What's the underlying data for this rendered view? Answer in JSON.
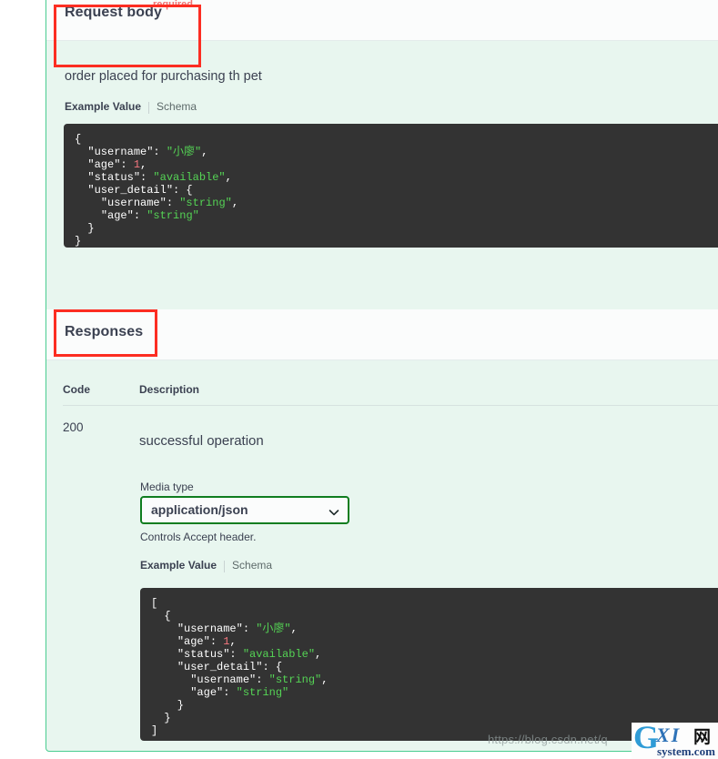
{
  "request_body": {
    "title": "Request body",
    "required_label": "required",
    "description": "order placed for purchasing th pet",
    "tabs": {
      "active": "Example Value",
      "inactive": "Schema"
    },
    "example_lines": [
      [
        {
          "t": "{",
          "c": "pun"
        }
      ],
      [
        {
          "t": "  ",
          "c": "pun"
        },
        {
          "t": "\"username\"",
          "c": "k"
        },
        {
          "t": ": ",
          "c": "pun"
        },
        {
          "t": "\"小廖\"",
          "c": "str"
        },
        {
          "t": ",",
          "c": "pun"
        }
      ],
      [
        {
          "t": "  ",
          "c": "pun"
        },
        {
          "t": "\"age\"",
          "c": "k"
        },
        {
          "t": ": ",
          "c": "pun"
        },
        {
          "t": "1",
          "c": "num"
        },
        {
          "t": ",",
          "c": "pun"
        }
      ],
      [
        {
          "t": "  ",
          "c": "pun"
        },
        {
          "t": "\"status\"",
          "c": "k"
        },
        {
          "t": ": ",
          "c": "pun"
        },
        {
          "t": "\"available\"",
          "c": "str"
        },
        {
          "t": ",",
          "c": "pun"
        }
      ],
      [
        {
          "t": "  ",
          "c": "pun"
        },
        {
          "t": "\"user_detail\"",
          "c": "k"
        },
        {
          "t": ": {",
          "c": "pun"
        }
      ],
      [
        {
          "t": "    ",
          "c": "pun"
        },
        {
          "t": "\"username\"",
          "c": "k"
        },
        {
          "t": ": ",
          "c": "pun"
        },
        {
          "t": "\"string\"",
          "c": "str"
        },
        {
          "t": ",",
          "c": "pun"
        }
      ],
      [
        {
          "t": "    ",
          "c": "pun"
        },
        {
          "t": "\"age\"",
          "c": "k"
        },
        {
          "t": ": ",
          "c": "pun"
        },
        {
          "t": "\"string\"",
          "c": "str"
        }
      ],
      [
        {
          "t": "  }",
          "c": "pun"
        }
      ],
      [
        {
          "t": "}",
          "c": "pun"
        }
      ]
    ]
  },
  "responses": {
    "title": "Responses",
    "columns": [
      "Code",
      "Description"
    ],
    "rows": [
      {
        "code": "200",
        "description": "successful operation",
        "media_type_label": "Media type",
        "media_type_value": "application/json",
        "media_type_options": [
          "application/json"
        ],
        "accept_note": "Controls Accept header.",
        "tabs": {
          "active": "Example Value",
          "inactive": "Schema"
        },
        "example_lines": [
          [
            {
              "t": "[",
              "c": "pun"
            }
          ],
          [
            {
              "t": "  {",
              "c": "pun"
            }
          ],
          [
            {
              "t": "    ",
              "c": "pun"
            },
            {
              "t": "\"username\"",
              "c": "k"
            },
            {
              "t": ": ",
              "c": "pun"
            },
            {
              "t": "\"小廖\"",
              "c": "str"
            },
            {
              "t": ",",
              "c": "pun"
            }
          ],
          [
            {
              "t": "    ",
              "c": "pun"
            },
            {
              "t": "\"age\"",
              "c": "k"
            },
            {
              "t": ": ",
              "c": "pun"
            },
            {
              "t": "1",
              "c": "num"
            },
            {
              "t": ",",
              "c": "pun"
            }
          ],
          [
            {
              "t": "    ",
              "c": "pun"
            },
            {
              "t": "\"status\"",
              "c": "k"
            },
            {
              "t": ": ",
              "c": "pun"
            },
            {
              "t": "\"available\"",
              "c": "str"
            },
            {
              "t": ",",
              "c": "pun"
            }
          ],
          [
            {
              "t": "    ",
              "c": "pun"
            },
            {
              "t": "\"user_detail\"",
              "c": "k"
            },
            {
              "t": ": {",
              "c": "pun"
            }
          ],
          [
            {
              "t": "      ",
              "c": "pun"
            },
            {
              "t": "\"username\"",
              "c": "k"
            },
            {
              "t": ": ",
              "c": "pun"
            },
            {
              "t": "\"string\"",
              "c": "str"
            },
            {
              "t": ",",
              "c": "pun"
            }
          ],
          [
            {
              "t": "      ",
              "c": "pun"
            },
            {
              "t": "\"age\"",
              "c": "k"
            },
            {
              "t": ": ",
              "c": "pun"
            },
            {
              "t": "\"string\"",
              "c": "str"
            }
          ],
          [
            {
              "t": "    }",
              "c": "pun"
            }
          ],
          [
            {
              "t": "  }",
              "c": "pun"
            }
          ],
          [
            {
              "t": "]",
              "c": "pun"
            }
          ]
        ]
      }
    ]
  },
  "watermark": {
    "url": "https://blog.csdn.net/q",
    "logo_g": "G",
    "logo_xi": "XI",
    "logo_wang": "网",
    "logo_sub": "system.com"
  },
  "colors": {
    "panel_border": "#49cc90",
    "panel_bg": "#e8f6ef",
    "header_bg": "#fbfcfc",
    "code_bg": "#333333",
    "string_green": "#55d455",
    "number_red": "#f5777f",
    "required_red": "#f2706f",
    "annotation_red": "#fc2d22",
    "select_border": "#0f7d1f",
    "text": "#3b4151"
  }
}
